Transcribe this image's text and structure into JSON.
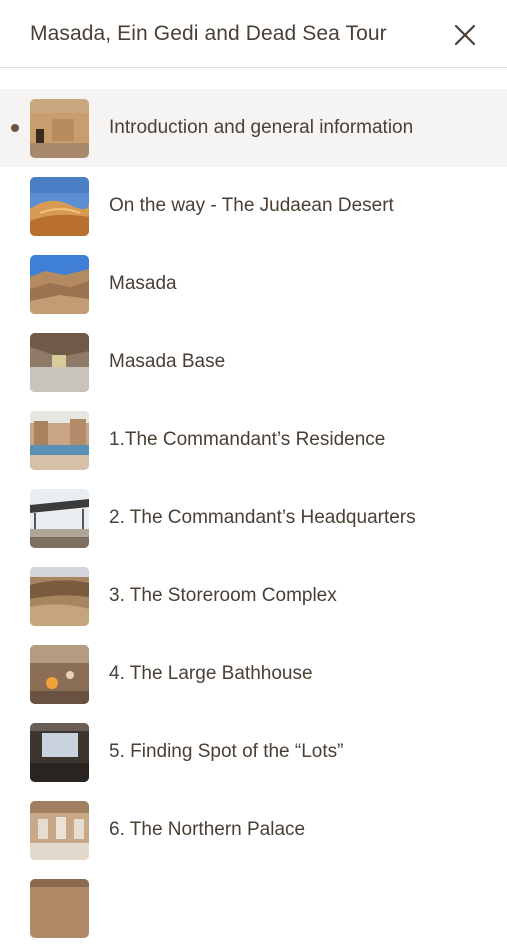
{
  "header": {
    "title": "Masada, Ein Gedi and Dead Sea Tour",
    "close_icon": "close-icon"
  },
  "list": {
    "active_index": 0,
    "items": [
      {
        "label": "Introduction and general information",
        "thumb": "ruins-photo"
      },
      {
        "label": "On the way - The Judaean Desert",
        "thumb": "desert-dunes-photo"
      },
      {
        "label": "Masada",
        "thumb": "mountain-photo"
      },
      {
        "label": "Masada Base",
        "thumb": "base-photo"
      },
      {
        "label": "1.The Commandant’s Residence",
        "thumb": "residence-photo"
      },
      {
        "label": "2. The Commandant’s Headquarters",
        "thumb": "headquarters-photo"
      },
      {
        "label": "3. The Storeroom Complex",
        "thumb": "storeroom-photo"
      },
      {
        "label": "4. The Large Bathhouse",
        "thumb": "bathhouse-photo"
      },
      {
        "label": "5. Finding Spot of the “Lots”",
        "thumb": "lots-photo"
      },
      {
        "label": "6. The Northern Palace",
        "thumb": "palace-photo"
      }
    ]
  },
  "colors": {
    "text": "#4a3f35",
    "active_background": "#f5f4f3",
    "divider": "#e3e0dc"
  }
}
